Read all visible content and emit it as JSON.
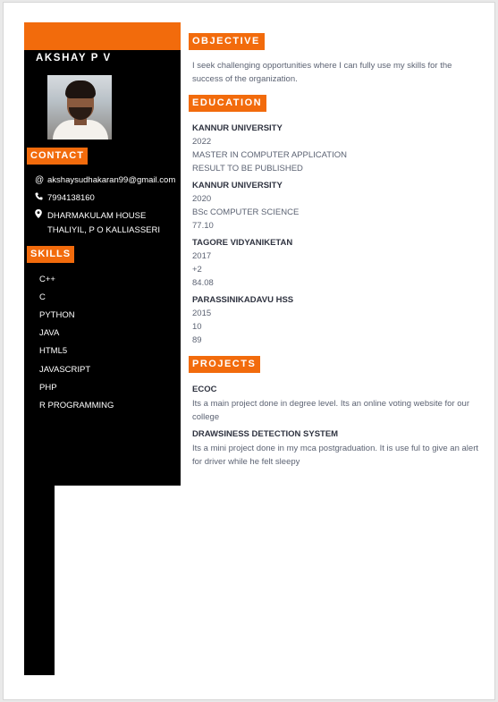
{
  "name": "AKSHAY P V",
  "accent_color": "#f26b0c",
  "contact": {
    "heading": "CONTACT",
    "email": "akshaysudhakaran99@gmail.com",
    "phone": "7994138160",
    "address": "DHARMAKULAM HOUSE THALIYIL, P O KALLIASSERI",
    "icons": [
      "at-sign-icon",
      "phone-icon",
      "map-pin-icon"
    ]
  },
  "skills": {
    "heading": "SKILLS",
    "items": [
      "C++",
      "C",
      "PYTHON",
      "JAVA",
      "HTML5",
      "JAVASCRIPT",
      "PHP",
      "R PROGRAMMING"
    ]
  },
  "objective": {
    "heading": "OBJECTIVE",
    "text": "I seek challenging opportunities where I can fully use my skills for the success of the organization."
  },
  "education": {
    "heading": "EDUCATION",
    "entries": [
      {
        "institution": "KANNUR UNIVERSITY",
        "lines": [
          "2022",
          "MASTER IN COMPUTER APPLICATION",
          "RESULT TO BE PUBLISHED"
        ]
      },
      {
        "institution": "KANNUR UNIVERSITY",
        "lines": [
          "2020",
          "BSc COMPUTER SCIENCE",
          "77.10"
        ]
      },
      {
        "institution": "TAGORE VIDYANIKETAN",
        "lines": [
          "2017",
          "+2",
          "84.08"
        ]
      },
      {
        "institution": "PARASSINIKADAVU HSS",
        "lines": [
          "2015",
          "10",
          "89"
        ]
      }
    ]
  },
  "projects": {
    "heading": "PROJECTS",
    "entries": [
      {
        "title": "ECOC",
        "description": "Its a main project done in degree level. Its an online voting website for our college"
      },
      {
        "title": "DRAWSINESS DETECTION SYSTEM",
        "description": "Its a mini project done in my mca postgraduation. It is use ful to give an alert for driver while he felt sleepy"
      }
    ]
  }
}
